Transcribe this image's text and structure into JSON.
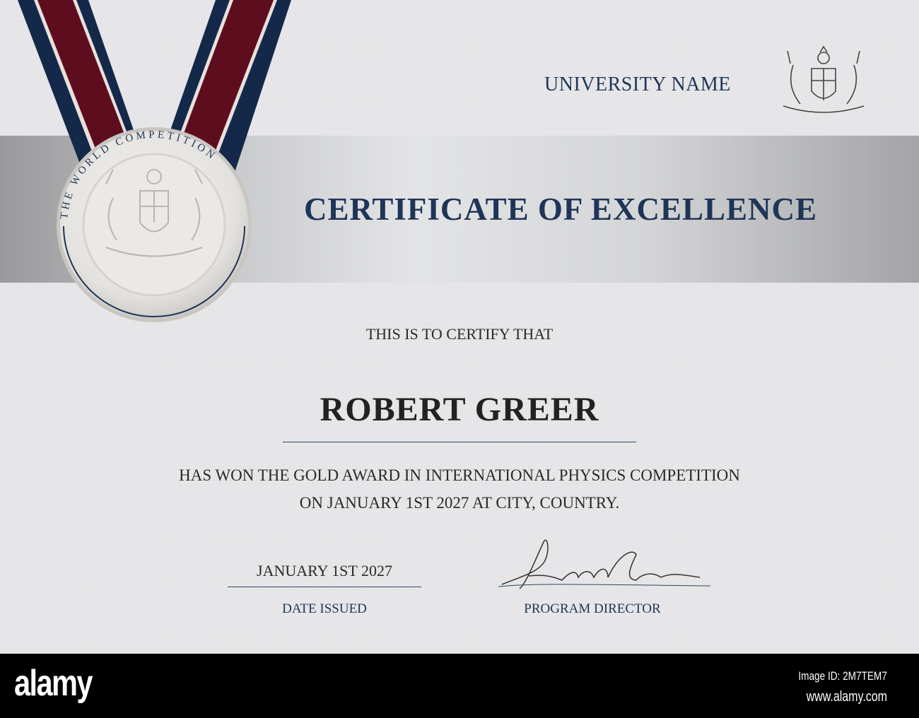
{
  "certificate": {
    "university_name": "UNIVERSITY NAME",
    "title": "CERTIFICATE OF EXCELLENCE",
    "medal_text": "THE WORLD COMPETITION",
    "certify_text": "THIS IS TO CERTIFY THAT",
    "recipient_name": "ROBERT GREER",
    "body_line1": "HAS WON THE GOLD AWARD IN INTERNATIONAL PHYSICS COMPETITION",
    "body_line2": "ON JANUARY 1ST 2027 AT CITY, COUNTRY.",
    "date_value": "JANUARY 1ST 2027",
    "date_label": "DATE ISSUED",
    "signature_label": "PROGRAM DIRECTOR"
  },
  "footer": {
    "brand": "alamy",
    "image_id": "Image ID: 2M7TEM7",
    "url": "www.alamy.com"
  },
  "colors": {
    "navy": "#1f3557",
    "ribbon_red": "#5e0d1e",
    "ribbon_blue": "#14284a"
  }
}
